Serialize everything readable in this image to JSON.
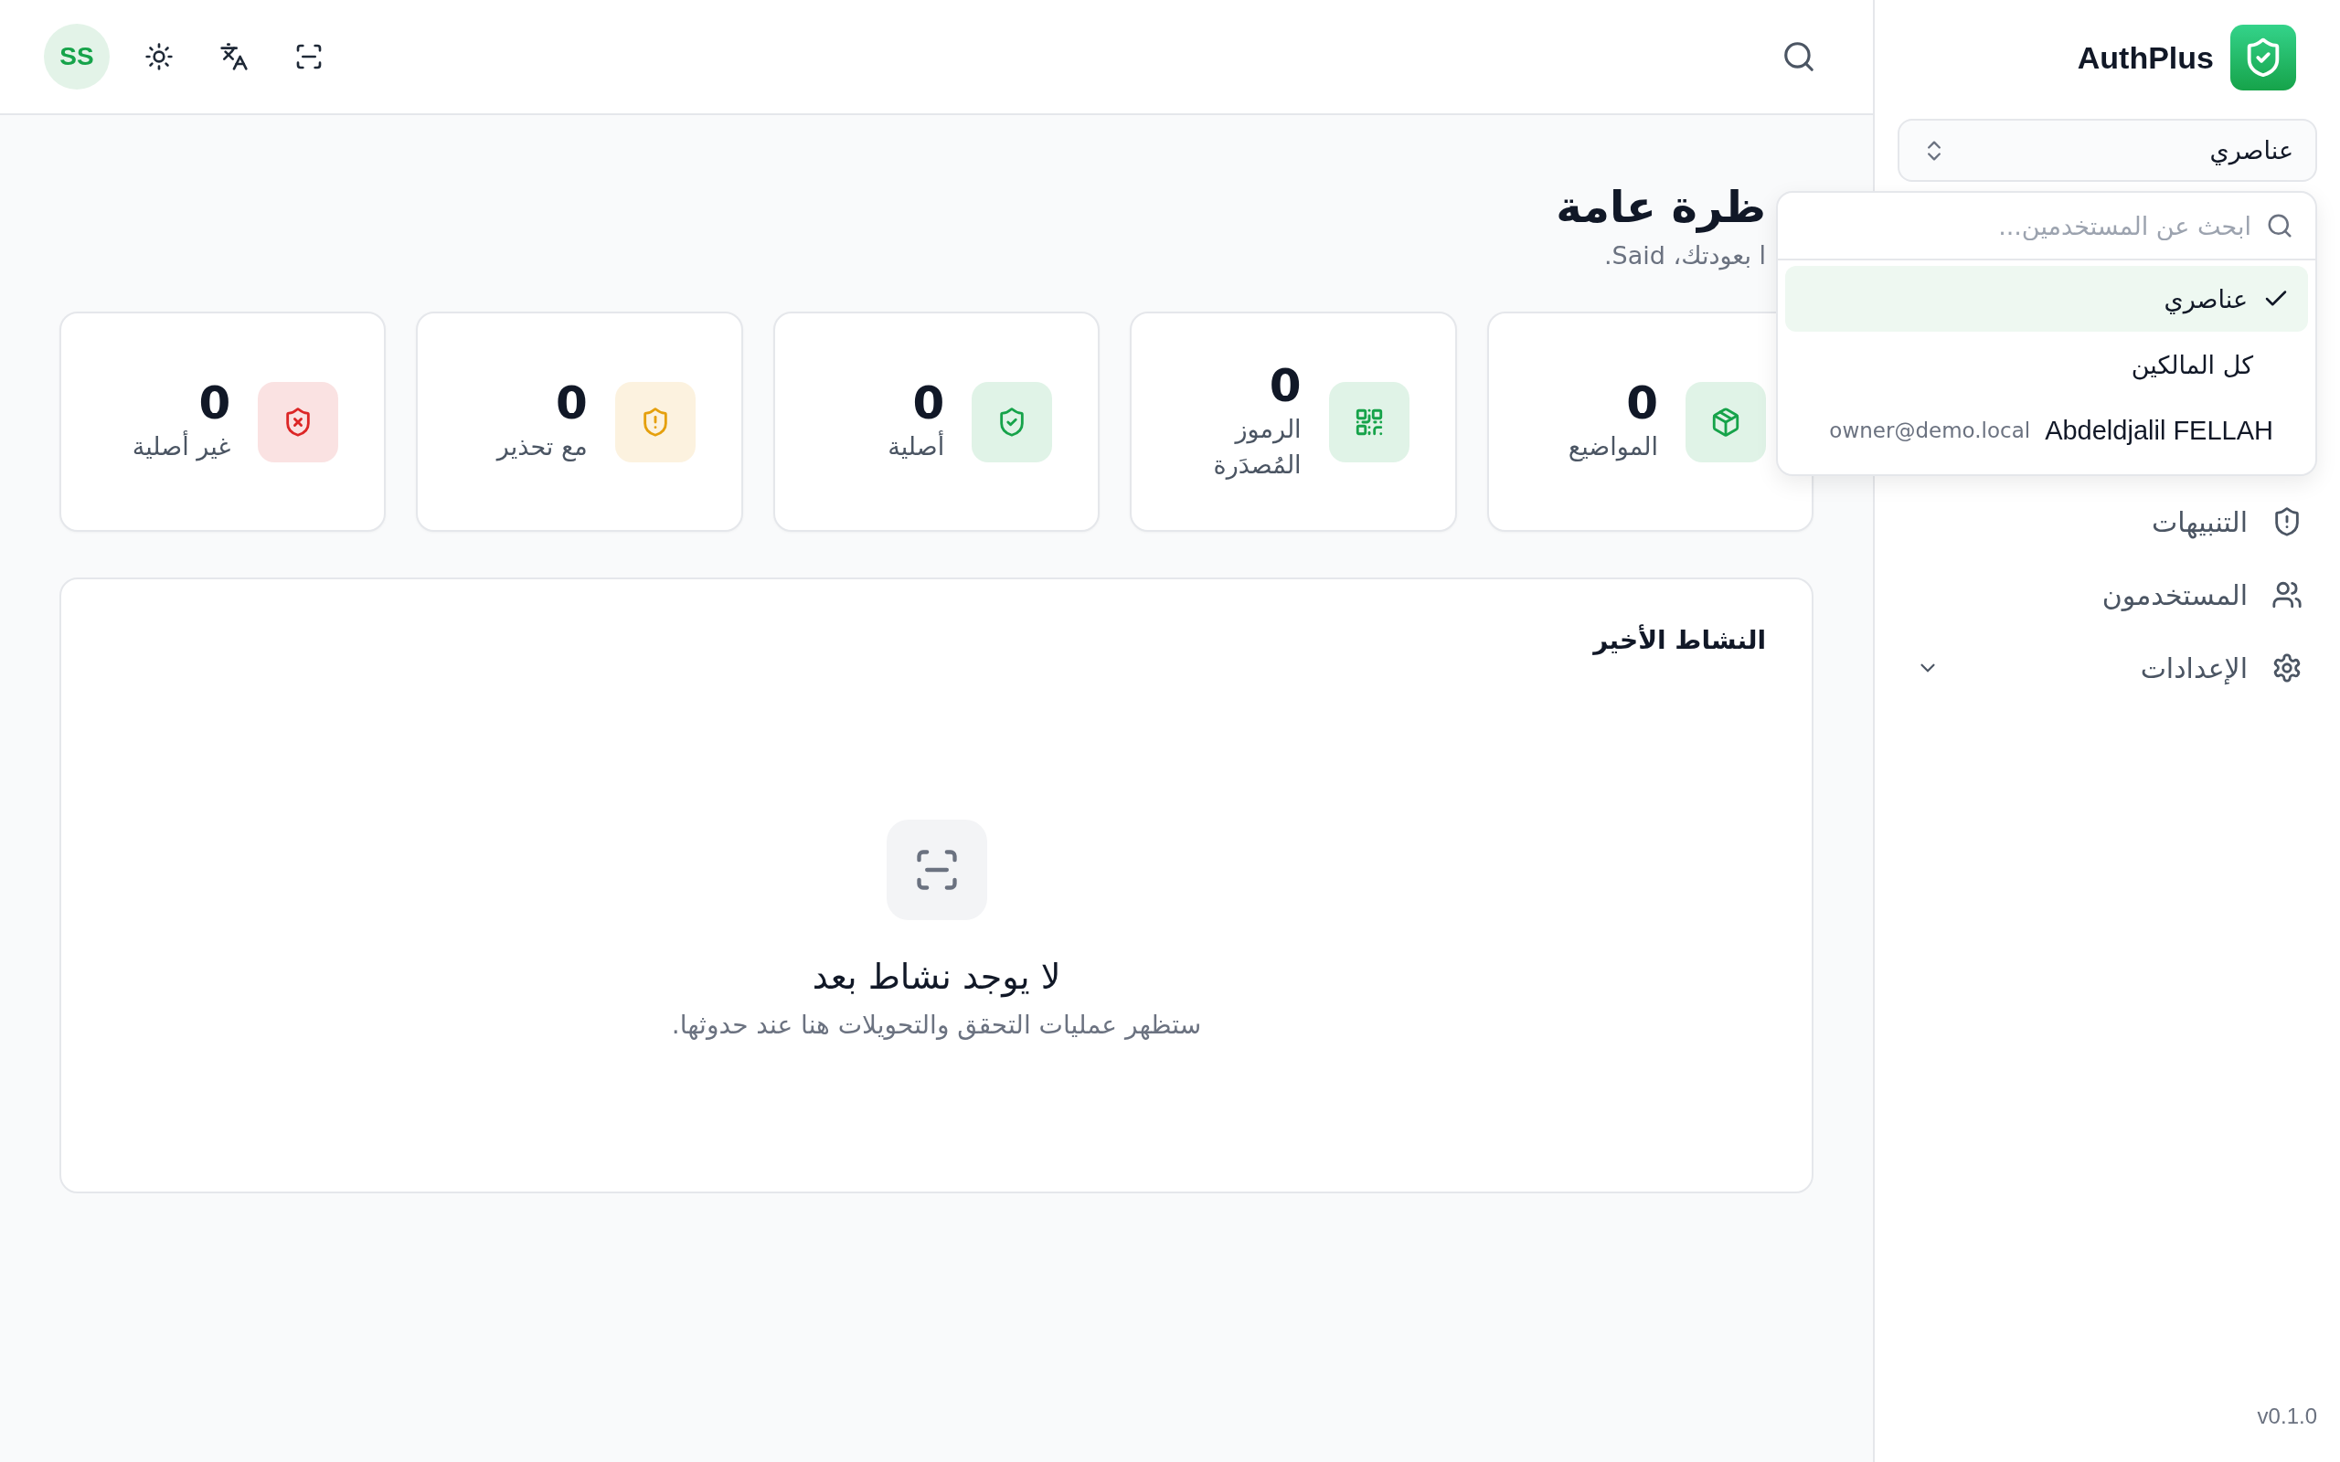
{
  "top_bar": {
    "avatar_initials": "SS"
  },
  "sidebar": {
    "brand": "AuthPlus",
    "scope_select": {
      "value": "عناصري"
    },
    "scope_menu": {
      "search": {
        "placeholder": "ابحث عن المستخدمين..."
      },
      "options": [
        {
          "kind": "option",
          "label": "عناصري",
          "selected": true
        },
        {
          "kind": "option",
          "label": "كل المالكين",
          "selected": false
        },
        {
          "kind": "user",
          "label": "Abdeldjalil FELLAH",
          "email": "owner@demo.local",
          "selected": false
        }
      ]
    },
    "nav": [
      {
        "kind": "alerts",
        "label": "التنبيهات"
      },
      {
        "kind": "users",
        "label": "المستخدمون"
      },
      {
        "kind": "settings",
        "label": "الإعدادات",
        "expanded": false
      }
    ],
    "version": "v0.1.0"
  },
  "page": {
    "title": "ظرة عامة",
    "subtitle": "ا بعودتك، Said."
  },
  "stats": [
    {
      "kind": "box",
      "value": "0",
      "label": "المواضيع",
      "color": "#16a34a"
    },
    {
      "kind": "qr",
      "value": "0",
      "label": "الرموز المُصدَرة",
      "color": "#16a34a"
    },
    {
      "kind": "shield-check",
      "value": "0",
      "label": "أصلية",
      "color": "#16a34a"
    },
    {
      "kind": "shield-alert",
      "value": "0",
      "label": "مع تحذير",
      "color": "#e5a00d"
    },
    {
      "kind": "shield-x",
      "value": "0",
      "label": "غير أصلية",
      "color": "#dc2626"
    }
  ],
  "recent_activity": {
    "title": "النشاط الأخير",
    "empty_title": "لا يوجد نشاط بعد",
    "empty_text": "ستظهر عمليات التحقق والتحويلات هنا عند حدوثها."
  }
}
